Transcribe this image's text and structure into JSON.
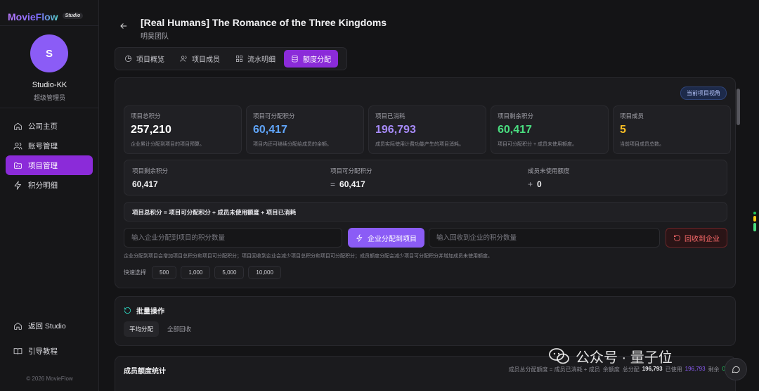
{
  "brand": {
    "name": "MovieFlow",
    "badge": "Studio"
  },
  "user": {
    "initial": "S",
    "name": "Studio-KK",
    "role": "超级管理员"
  },
  "nav": {
    "items": [
      {
        "label": "公司主页",
        "icon": "home-icon"
      },
      {
        "label": "账号管理",
        "icon": "users-icon"
      },
      {
        "label": "项目管理",
        "icon": "folder-icon",
        "active": true
      },
      {
        "label": "积分明细",
        "icon": "bolt-icon"
      }
    ],
    "bottom": [
      {
        "label": "返回 Studio",
        "icon": "home-icon"
      },
      {
        "label": "引导教程",
        "icon": "book-icon"
      }
    ],
    "copyright": "© 2026 MovieFlow"
  },
  "header": {
    "title": "[Real Humans] The Romance of the Three Kingdoms",
    "subtitle": "明昊团队"
  },
  "tabs": [
    {
      "label": "项目概览",
      "icon": "clock-icon"
    },
    {
      "label": "项目成员",
      "icon": "users-icon"
    },
    {
      "label": "流水明细",
      "icon": "grid-icon"
    },
    {
      "label": "额度分配",
      "icon": "database-icon",
      "active": true
    }
  ],
  "panel": {
    "view_badge": "当前项目视角",
    "stats": [
      {
        "label": "项目总积分",
        "value": "257,210",
        "desc": "企业累计分配到项目的项目预算。",
        "color": "#ffffff"
      },
      {
        "label": "项目可分配积分",
        "value": "60,417",
        "desc": "项目内还可继续分配给成员的余额。",
        "color": "#60a5fa"
      },
      {
        "label": "项目已消耗",
        "value": "196,793",
        "desc": "成员实际使用计费功能产生的项目消耗。",
        "color": "#a78bfa"
      },
      {
        "label": "项目剩余积分",
        "value": "60,417",
        "desc": "项目可分配积分 + 成员未使用额度。",
        "color": "#4ade80"
      },
      {
        "label": "项目成员",
        "value": "5",
        "desc": "当前项目成员总数。",
        "color": "#fbbf24"
      }
    ],
    "summary": [
      {
        "label": "项目剩余积分",
        "op": "",
        "value": "60,417"
      },
      {
        "label": "项目可分配积分",
        "op": "=",
        "value": "60,417"
      },
      {
        "label": "成员未使用额度",
        "op": "+",
        "value": "0"
      }
    ],
    "formula": "项目总积分 = 项目可分配积分 + 成员未使用额度 + 项目已消耗",
    "alloc_input_placeholder": "输入企业分配到项目的积分数量",
    "alloc_button": "企业分配到项目",
    "recycle_input_placeholder": "输入回收到企业的积分数量",
    "recycle_button": "回收到企业",
    "hint": "企业分配到项目会增加项目总积分和项目可分配积分；项目回收到企业会减少项目总积分和项目可分配积分；成员额度分配会减少项目可分配积分并增加成员未使用额度。",
    "quick_label": "快速选择",
    "quick_values": [
      "500",
      "1,000",
      "5,000",
      "10,000"
    ]
  },
  "batch": {
    "title": "批量操作",
    "tabs": [
      {
        "label": "平均分配",
        "active": true
      },
      {
        "label": "全部回收"
      }
    ]
  },
  "members": {
    "title": "成员额度统计",
    "info_prefix": "成员总分配额度 = 成员已消耗 + 成员",
    "info_mid1": "余额度",
    "info_total_label": "总分配",
    "info_total": "196,793",
    "info_used_label": "已使用",
    "info_used": "196,793",
    "info_remain_label": "剩余",
    "info_remain": "0"
  },
  "watermark": {
    "text": "公众号 · 量子位"
  },
  "colors": {
    "accent": "#8b2bd9",
    "primary_button": "#8b5cf6",
    "danger": "#ff6b6b"
  }
}
